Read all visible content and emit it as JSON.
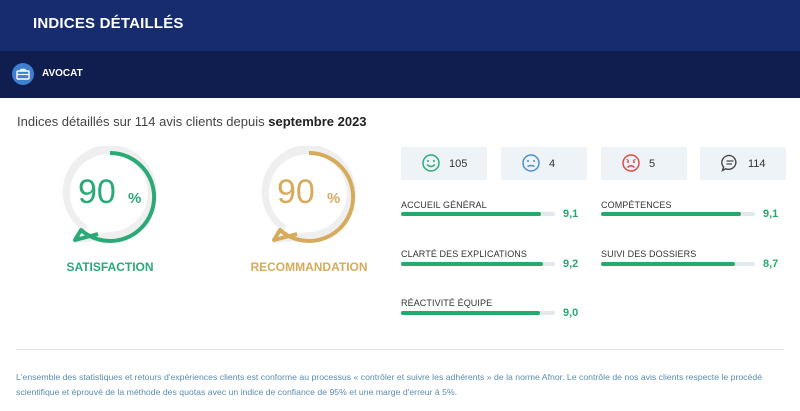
{
  "header": {
    "title": "INDICES DÉTAILLÉS"
  },
  "subheader": {
    "icon": "briefcase-icon",
    "title": "AVOCAT"
  },
  "intro": {
    "prefix": "Indices détaillés sur 114 avis clients depuis",
    "date": "septembre 2023"
  },
  "gauges": [
    {
      "value": "90",
      "unit": "%",
      "label": "SATISFACTION",
      "percent": 90,
      "color": "#2aaa77"
    },
    {
      "value": "90",
      "unit": "%",
      "label": "RECOMMANDATION",
      "percent": 90,
      "color": "#d6ab5c"
    }
  ],
  "counts": [
    {
      "icon": "smile-face-icon",
      "value": "105",
      "color": "#2aaa77"
    },
    {
      "icon": "neutral-face-icon",
      "value": "4",
      "color": "#4a8fd0"
    },
    {
      "icon": "sad-face-icon",
      "value": "5",
      "color": "#e04848"
    },
    {
      "icon": "comment-icon",
      "value": "114",
      "color": "#444444"
    }
  ],
  "metrics": [
    {
      "label": "ACCUEIL GÉNÉRAL",
      "value": "9,1",
      "fraction": 0.91
    },
    {
      "label": "COMPÉTENCES",
      "value": "9,1",
      "fraction": 0.91
    },
    {
      "label": "CLARTÉ DES EXPLICATIONS",
      "value": "9,2",
      "fraction": 0.92
    },
    {
      "label": "SUIVI DES DOSSIERS",
      "value": "8,7",
      "fraction": 0.87
    },
    {
      "label": "RÉACTIVITÉ ÉQUIPE",
      "value": "9,0",
      "fraction": 0.9
    }
  ],
  "footer": {
    "text": "L'ensemble des statistiques et retours d'expériences clients est conforme au processus « contrôler et suivre les adhérents » de la norme Afnor. Le contrôle de nos avis clients respecte le procédé scientifique et éprouvé de la méthode des quotas avec un indice de confiance de 95% et une marge d'erreur à 5%."
  },
  "colors": {
    "header": "#172c6e",
    "subheader": "#0f1e4e",
    "accent_green": "#26a96c",
    "bar_track": "#e3e8ec"
  }
}
